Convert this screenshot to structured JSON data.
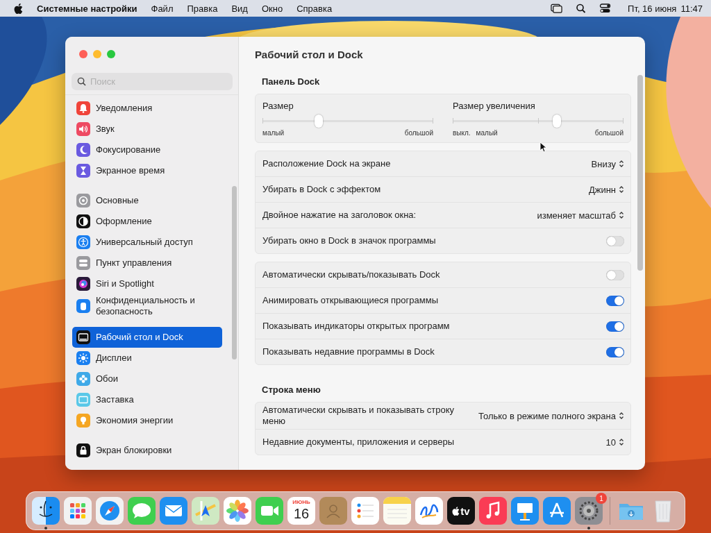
{
  "menubar": {
    "app_name": "Системные настройки",
    "menus": [
      "Файл",
      "Правка",
      "Вид",
      "Окно",
      "Справка"
    ],
    "date": "Пт, 16 июня",
    "time": "11:47"
  },
  "window": {
    "title": "Рабочий стол и Dock",
    "sidebar": {
      "search": {
        "placeholder": "Поиск"
      },
      "groups": [
        [
          {
            "label": "Уведомления",
            "kind": "bell",
            "color": "#f0443a",
            "selected": false
          },
          {
            "label": "Звук",
            "kind": "speaker",
            "color": "#ee4a62",
            "selected": false
          },
          {
            "label": "Фокусирование",
            "kind": "moon",
            "color": "#6a5ae0",
            "selected": false
          },
          {
            "label": "Экранное время",
            "kind": "hourglass",
            "color": "#6a5ae0",
            "selected": false
          }
        ],
        [
          {
            "label": "Основные",
            "kind": "gear",
            "color": "#9a9a9e",
            "selected": false
          },
          {
            "label": "Оформление",
            "kind": "appearance",
            "color": "#111111",
            "selected": false
          },
          {
            "label": "Универсальный доступ",
            "kind": "accessibility",
            "color": "#1a7ff0",
            "selected": false
          },
          {
            "label": "Пункт управления",
            "kind": "toggles",
            "color": "#9a9a9e",
            "selected": false
          },
          {
            "label": "Siri и Spotlight",
            "kind": "orb",
            "color": "#2a1a3a",
            "selected": false
          },
          {
            "label": "Конфиденциальность и безопасность",
            "kind": "hand",
            "color": "#1a7ff0",
            "selected": false
          }
        ],
        [
          {
            "label": "Рабочий стол и Dock",
            "kind": "dock",
            "color": "#111111",
            "selected": true
          },
          {
            "label": "Дисплеи",
            "kind": "sun",
            "color": "#1a7ff0",
            "selected": false
          },
          {
            "label": "Обои",
            "kind": "flower",
            "color": "#3fa9e8",
            "selected": false
          },
          {
            "label": "Заставка",
            "kind": "screen",
            "color": "#5ac8e8",
            "selected": false
          },
          {
            "label": "Экономия энергии",
            "kind": "bulb",
            "color": "#f5a623",
            "selected": false
          }
        ],
        [
          {
            "label": "Экран блокировки",
            "kind": "lock",
            "color": "#111111",
            "selected": false
          }
        ]
      ]
    },
    "sections": [
      {
        "heading": "Панель Dock",
        "cards": [
          {
            "kind": "sliders",
            "sliders": [
              {
                "label": "Размер",
                "level": 0.33,
                "ticks": [
                  "малый",
                  "большой"
                ]
              },
              {
                "label": "Размер увеличения",
                "level": 0.61,
                "ticks": [
                  "выкл.",
                  "малый",
                  "большой"
                ]
              }
            ]
          },
          {
            "kind": "rows",
            "rows": [
              {
                "kind": "popup",
                "label": "Расположение Dock на экране",
                "value": "Внизу"
              },
              {
                "kind": "popup",
                "label": "Убирать в Dock с эффектом",
                "value": "Джинн"
              },
              {
                "kind": "popup",
                "label": "Двойное нажатие на заголовок окна:",
                "value": "изменяет масштаб"
              },
              {
                "kind": "toggle",
                "label": "Убирать окно в Dock в значок программы",
                "on": false
              }
            ]
          },
          {
            "kind": "rows",
            "rows": [
              {
                "kind": "toggle",
                "label": "Автоматически скрывать/показывать Dock",
                "on": false
              },
              {
                "kind": "toggle",
                "label": "Анимировать открывающиеся программы",
                "on": true
              },
              {
                "kind": "toggle",
                "label": "Показывать индикаторы открытых программ",
                "on": true
              },
              {
                "kind": "toggle",
                "label": "Показывать недавние программы в Dock",
                "on": true
              }
            ]
          }
        ]
      },
      {
        "heading": "Строка меню",
        "cards": [
          {
            "kind": "rows",
            "rows": [
              {
                "kind": "popup",
                "label": "Автоматически скрывать и показывать строку меню",
                "value": "Только в режиме полного экрана"
              },
              {
                "kind": "popup",
                "label": "Недавние документы, приложения и серверы",
                "value": "10"
              }
            ]
          }
        ]
      }
    ]
  },
  "dock": {
    "apps": [
      {
        "kind": "finder",
        "running": true
      },
      {
        "kind": "launchpad",
        "running": false
      },
      {
        "kind": "safari",
        "running": false
      },
      {
        "kind": "messages",
        "running": false
      },
      {
        "kind": "mail",
        "running": false
      },
      {
        "kind": "maps",
        "running": false
      },
      {
        "kind": "photos",
        "running": false
      },
      {
        "kind": "facetime",
        "running": false
      },
      {
        "kind": "calendar",
        "month": "ИЮНЬ",
        "day": "16",
        "running": false
      },
      {
        "kind": "contacts",
        "running": false
      },
      {
        "kind": "reminders",
        "running": false
      },
      {
        "kind": "notes",
        "running": false
      },
      {
        "kind": "freeform",
        "running": false
      },
      {
        "kind": "tv",
        "label": "tv",
        "running": false
      },
      {
        "kind": "music",
        "running": false
      },
      {
        "kind": "keynote",
        "running": false
      },
      {
        "kind": "appstore",
        "running": false
      },
      {
        "kind": "settings",
        "running": true,
        "badge": "1"
      }
    ],
    "others": [
      {
        "kind": "downloads"
      },
      {
        "kind": "trash"
      }
    ]
  }
}
